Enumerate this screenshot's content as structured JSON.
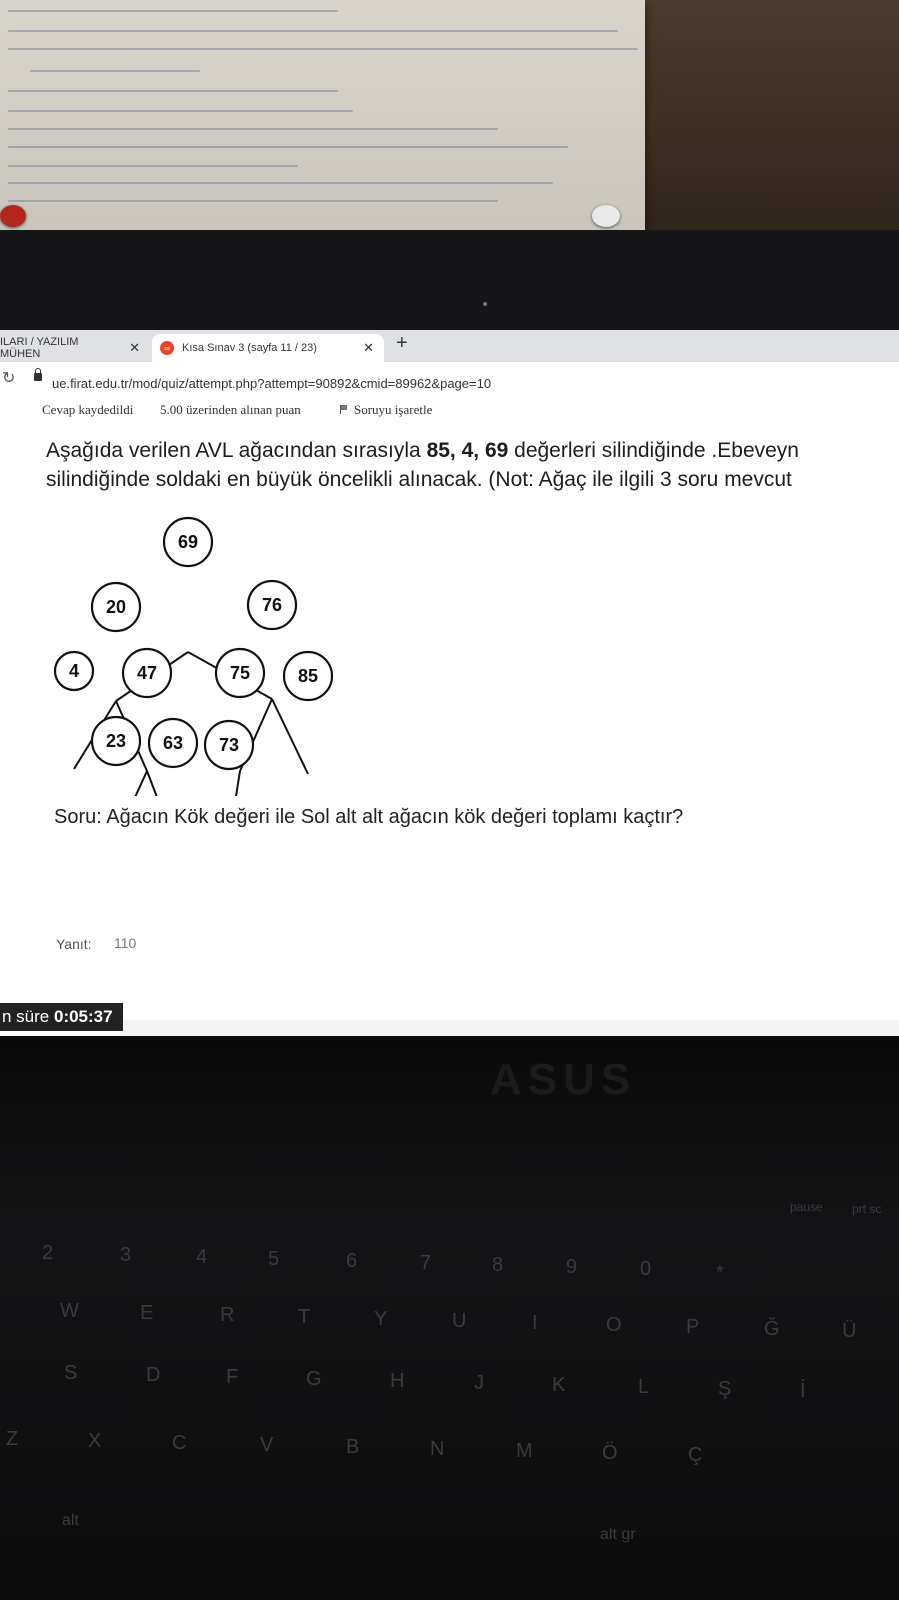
{
  "browser": {
    "tabs": [
      {
        "label": "ILARI / YAZILIM MÜHEN",
        "active": false
      },
      {
        "label": "Kısa Sınav 3 (sayfa 11 / 23)",
        "active": true
      }
    ],
    "url": "ue.firat.edu.tr/mod/quiz/attempt.php?attempt=90892&cmid=89962&page=10"
  },
  "quiz": {
    "status": "Cevap kaydedildi",
    "points": "5.00 üzerinden alınan puan",
    "flag_label": "Soruyu işaretle",
    "question_line1_a": "Aşağıda verilen AVL ağacından sırasıyla ",
    "question_line1_b": "85, 4, 69",
    "question_line1_c": " değerleri silindiğinde .Ebeveyn",
    "question_line2": "silindiğinde soldaki en büyük öncelikli alınacak. (Not: Ağaç ile ilgili 3 soru mevcut",
    "sub_question": "Soru: Ağacın Kök değeri ile Sol alt alt ağacın kök değeri toplamı kaçtır?",
    "answer_label": "Yanıt:",
    "answer_value": "110"
  },
  "tree": {
    "nodes": [
      "69",
      "20",
      "76",
      "4",
      "47",
      "75",
      "85",
      "23",
      "63",
      "73"
    ]
  },
  "timer": {
    "prefix": "n süre",
    "value": "0:05:37"
  },
  "keyboard": {
    "brand": "ASUS",
    "keys": [
      "2",
      "3",
      "4",
      "5",
      "6",
      "7",
      "8",
      "9",
      "0",
      "*",
      "W",
      "E",
      "R",
      "T",
      "Y",
      "U",
      "I",
      "O",
      "P",
      "Ğ",
      "Ü",
      "S",
      "D",
      "F",
      "G",
      "H",
      "J",
      "K",
      "L",
      "Ş",
      "İ",
      "Z",
      "X",
      "C",
      "V",
      "B",
      "N",
      "M",
      "Ö",
      "Ç",
      "alt",
      "alt gr",
      "pause",
      "prt sc"
    ]
  }
}
